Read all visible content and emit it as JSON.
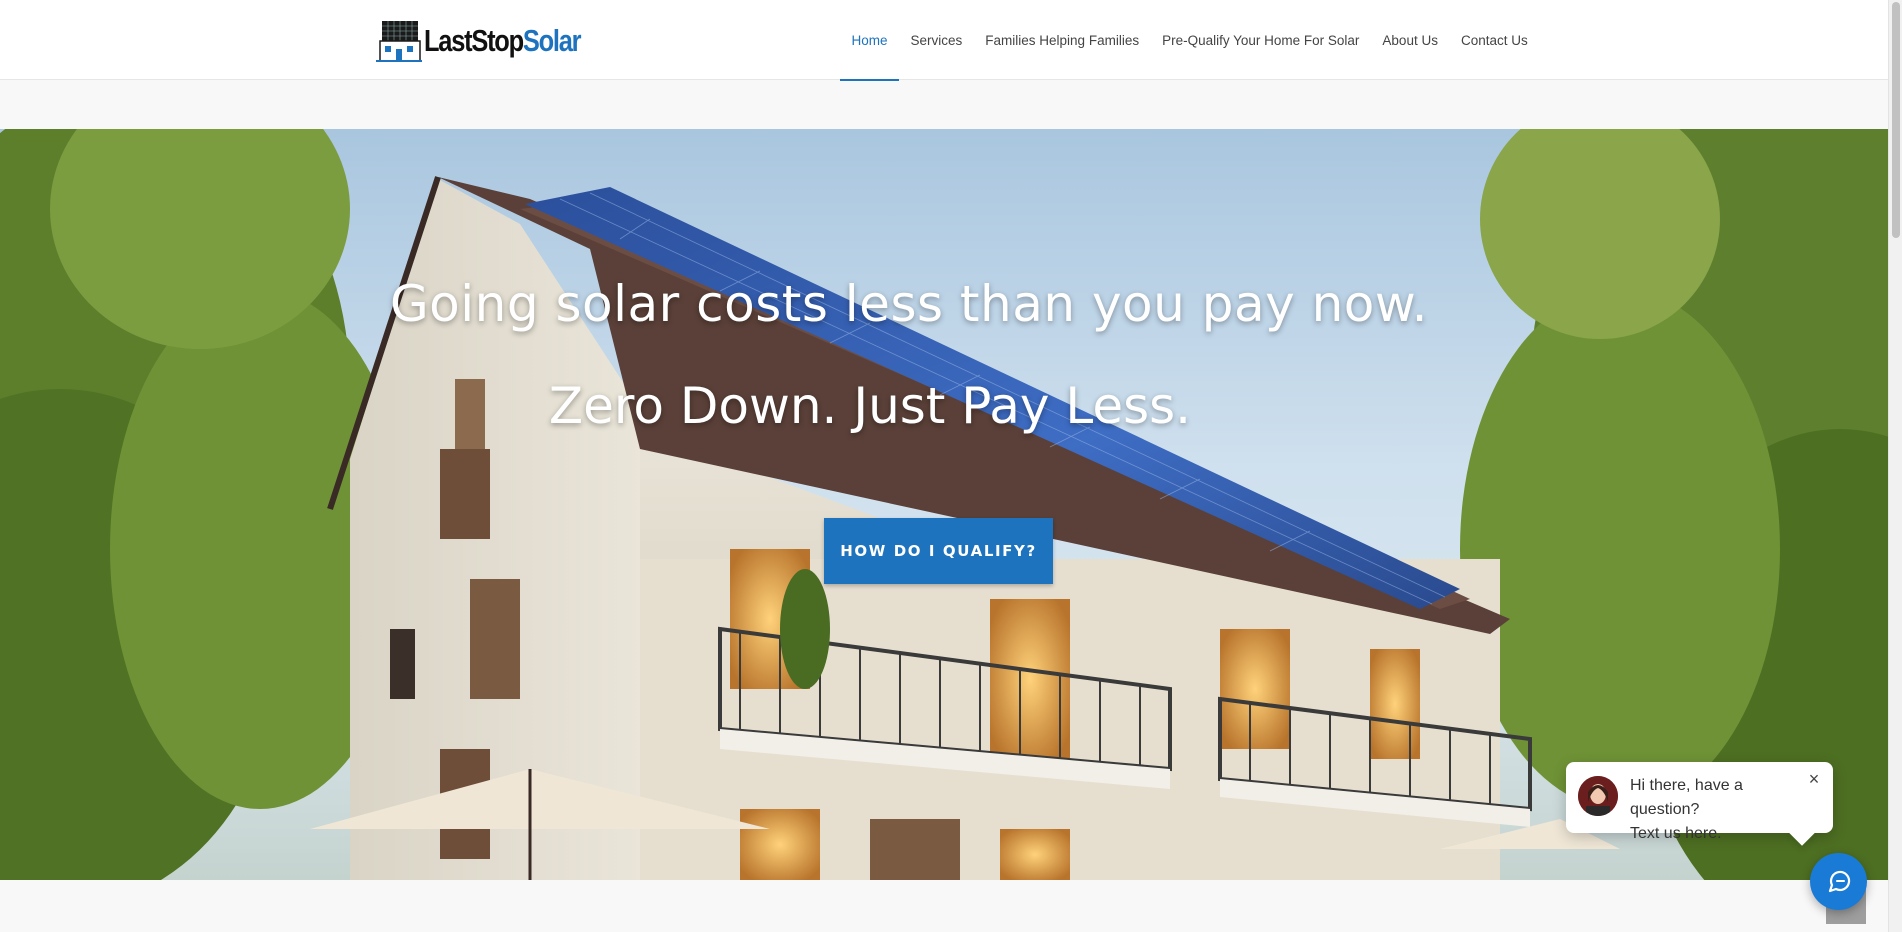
{
  "brand": {
    "name_part1": "LastStop",
    "name_part2": "Solar",
    "accent_color": "#1e73be"
  },
  "nav": {
    "items": [
      {
        "label": "Home",
        "active": true
      },
      {
        "label": "Services",
        "active": false
      },
      {
        "label": "Families Helping Families",
        "active": false
      },
      {
        "label": "Pre-Qualify Your Home For Solar",
        "active": false
      },
      {
        "label": "About Us",
        "active": false
      },
      {
        "label": "Contact Us",
        "active": false
      }
    ]
  },
  "hero": {
    "headline": "Going solar costs less than you pay now.",
    "subheadline": "Zero Down. Just Pay Less.",
    "cta_label": "HOW DO I QUALIFY?"
  },
  "chat": {
    "message_line1": "Hi there, have a question?",
    "message_line2": "Text us here.",
    "close_icon": "close-icon",
    "launcher_icon": "chat-icon"
  }
}
